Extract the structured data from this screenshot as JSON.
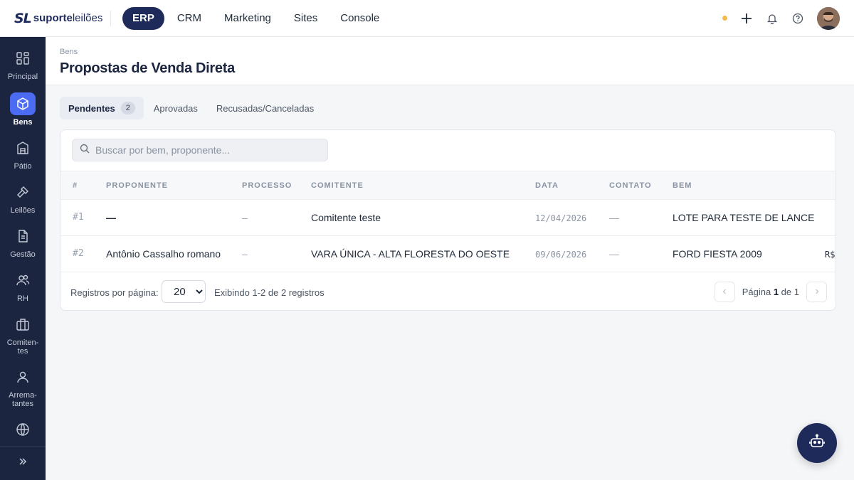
{
  "brand": {
    "mark": "SL",
    "name_bold": "suporte",
    "name_light": "leilões"
  },
  "nav": [
    {
      "label": "ERP",
      "active": true
    },
    {
      "label": "CRM"
    },
    {
      "label": "Marketing"
    },
    {
      "label": "Sites"
    },
    {
      "label": "Console"
    }
  ],
  "sidebar": {
    "items": [
      {
        "label": "Principal",
        "icon": "grid-icon"
      },
      {
        "label": "Bens",
        "icon": "cube-icon",
        "active": true
      },
      {
        "label": "Pátio",
        "icon": "warehouse-icon"
      },
      {
        "label": "Leilões",
        "icon": "gavel-icon"
      },
      {
        "label": "Gestão",
        "icon": "document-icon"
      },
      {
        "label": "RH",
        "icon": "users-icon"
      },
      {
        "label": "Comiten-tes",
        "icon": "briefcase-icon"
      },
      {
        "label": "Arrema-tantes",
        "icon": "user-icon"
      },
      {
        "label": "",
        "icon": "globe-icon"
      }
    ]
  },
  "page": {
    "breadcrumb": "Bens",
    "title": "Propostas de Venda Direta"
  },
  "tabs": [
    {
      "label": "Pendentes",
      "badge": "2",
      "active": true
    },
    {
      "label": "Aprovadas"
    },
    {
      "label": "Recusadas/Canceladas"
    }
  ],
  "search": {
    "placeholder": "Buscar por bem, proponente..."
  },
  "table": {
    "columns": [
      "#",
      "PROPONENTE",
      "PROCESSO",
      "COMITENTE",
      "DATA",
      "CONTATO",
      "BEM"
    ],
    "rows": [
      {
        "idx": "#1",
        "proponente": "—",
        "processo": "–",
        "comitente": "Comitente teste",
        "data": "12/04/2026",
        "contato": "—",
        "bem": "LOTE PARA TESTE DE LANCE",
        "extra": ""
      },
      {
        "idx": "#2",
        "proponente": "Antônio Cassalho romano",
        "processo": "–",
        "comitente": "VARA ÚNICA - ALTA FLORESTA DO OESTE",
        "data": "09/06/2026",
        "contato": "—",
        "bem": "FORD FIESTA 2009",
        "extra": "R$"
      }
    ]
  },
  "footer": {
    "per_page_label": "Registros por página:",
    "per_page_value": "20",
    "info": "Exibindo 1-2 de 2 registros",
    "page_prefix": "Página",
    "page_current": "1",
    "page_sep": "de",
    "page_total": "1"
  },
  "colors": {
    "primary": "#1e2a5a",
    "sidebar": "#1b2540",
    "accent": "#4b6bf2",
    "status_dot": "#f5b94a"
  }
}
